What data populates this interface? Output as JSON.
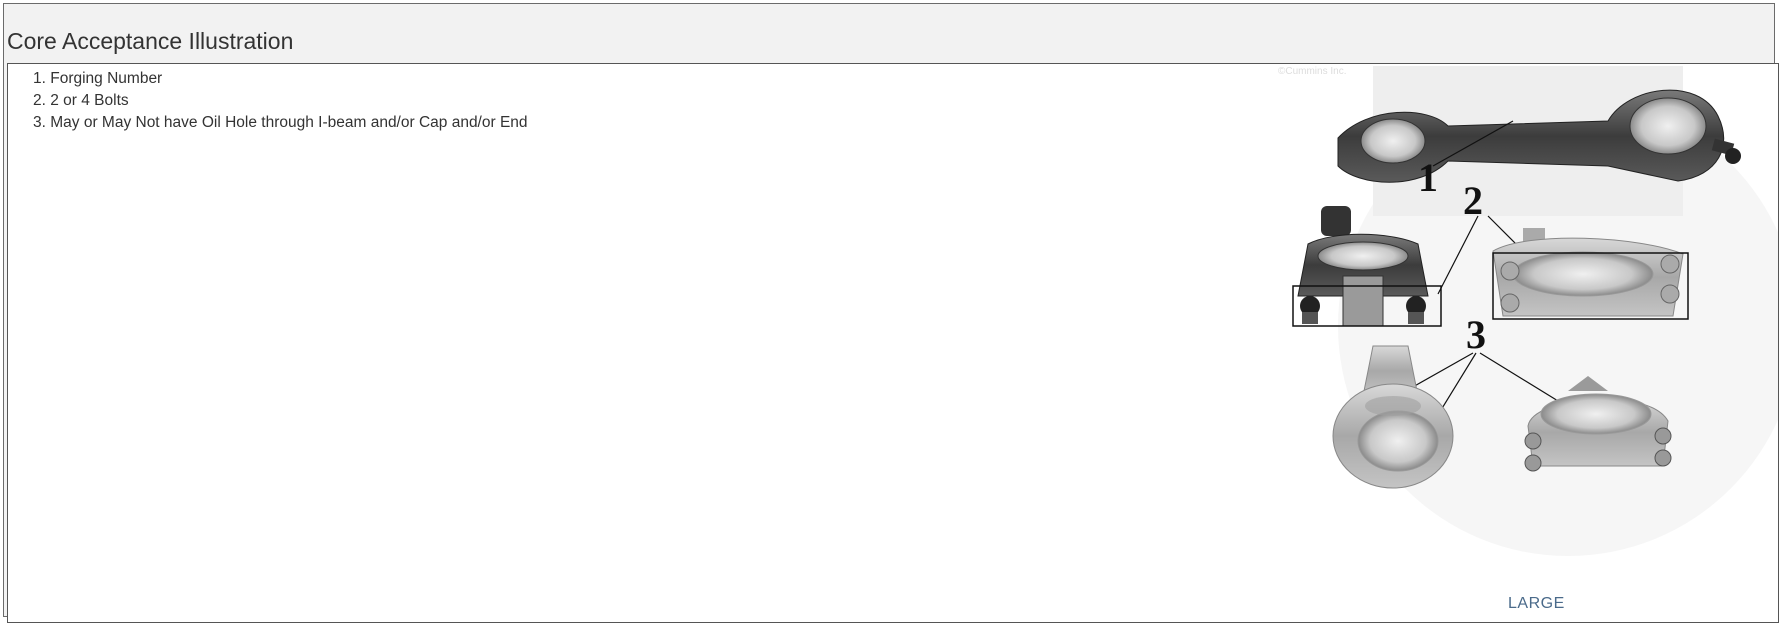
{
  "panel": {
    "title": "Core Acceptance Illustration"
  },
  "list": {
    "items": [
      "1. Forging Number",
      "2. 2 or 4 Bolts",
      "3. May or May Not have Oil Hole through I-beam and/or Cap and/or End"
    ]
  },
  "illustration": {
    "watermark": "©Cummins Inc.",
    "callouts": [
      "1",
      "2",
      "3"
    ],
    "colors": {
      "metal_dark": "#4a4a4a",
      "metal_light": "#b8b8b8",
      "outline": "#111111"
    }
  },
  "large_link": {
    "label": "LARGE"
  }
}
